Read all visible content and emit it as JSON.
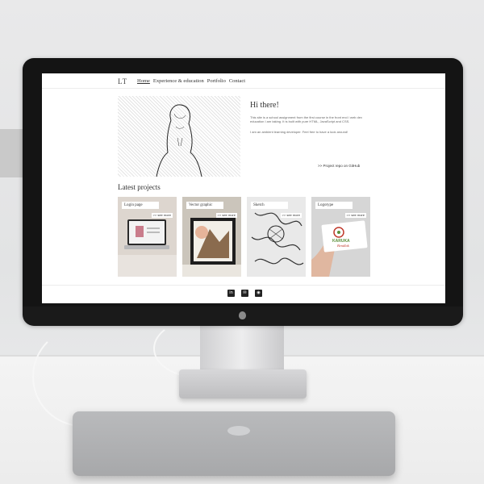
{
  "site": {
    "logo": "LT",
    "nav": [
      "Home",
      "Experience & education",
      "Portfolio",
      "Contact"
    ],
    "hero": {
      "heading": "Hi there!",
      "paragraph1": "This site is a school assignment from the first course in the front end / web dev education I am taking. It is built with pure HTML, JavaScript and CSS.",
      "paragraph2": "I am an ambient learning developer. Feel free to have a look around!",
      "repo_link": ">> Project repo on GitHub"
    },
    "latest_heading": "Latest projects",
    "projects": [
      {
        "title": "Login page",
        "more": ">> see more"
      },
      {
        "title": "Vector graphic",
        "more": ">> see more"
      },
      {
        "title": "Sketch",
        "more": ">> see more"
      },
      {
        "title": "Logotype",
        "more": ">> see more"
      }
    ],
    "social_icons": [
      "linkedin-icon",
      "mail-icon",
      "github-icon"
    ],
    "logotype_card_text": [
      "KARUKA",
      "Bendlak"
    ]
  },
  "colors": {
    "accent_green": "#5b8f3a",
    "accent_red": "#c0392b",
    "bezel": "#141414"
  }
}
